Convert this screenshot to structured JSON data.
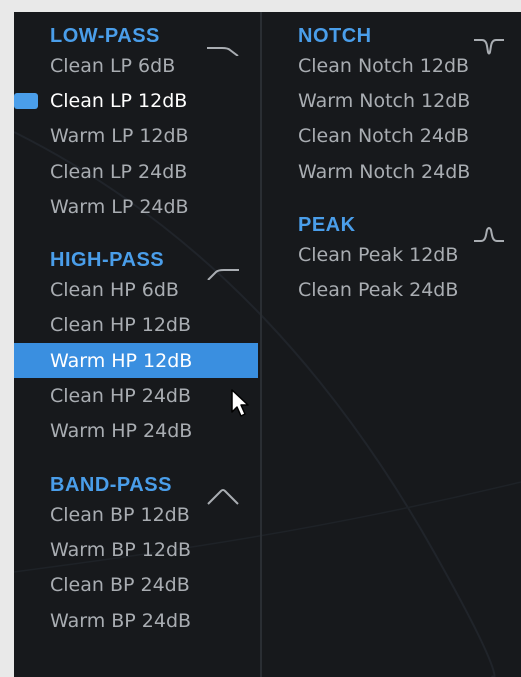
{
  "colors": {
    "background": "#17191c",
    "header": "#4a9eea",
    "item_text": "#a9adb2",
    "active_text": "#ffffff",
    "selection": "#3a8fe0"
  },
  "sections": {
    "low_pass": {
      "title": "LOW-PASS",
      "icon": "lowpass-curve-icon",
      "items": [
        "Clean LP 6dB",
        "Clean LP 12dB",
        "Warm LP 12dB",
        "Clean LP 24dB",
        "Warm LP 24dB"
      ]
    },
    "high_pass": {
      "title": "HIGH-PASS",
      "icon": "highpass-curve-icon",
      "items": [
        "Clean HP 6dB",
        "Clean HP 12dB",
        "Warm HP 12dB",
        "Clean HP 24dB",
        "Warm HP 24dB"
      ]
    },
    "band_pass": {
      "title": "BAND-PASS",
      "icon": "bandpass-curve-icon",
      "items": [
        "Clean BP 12dB",
        "Warm BP 12dB",
        "Clean BP 24dB",
        "Warm BP 24dB"
      ]
    },
    "notch": {
      "title": "NOTCH",
      "icon": "notch-curve-icon",
      "items": [
        "Clean Notch 12dB",
        "Warm Notch 12dB",
        "Clean Notch 24dB",
        "Warm Notch 24dB"
      ]
    },
    "peak": {
      "title": "PEAK",
      "icon": "peak-curve-icon",
      "items": [
        "Clean Peak 12dB",
        "Clean Peak 24dB"
      ]
    }
  },
  "state": {
    "active_item": "Clean LP 12dB",
    "hovered_item": "Warm HP 12dB"
  }
}
